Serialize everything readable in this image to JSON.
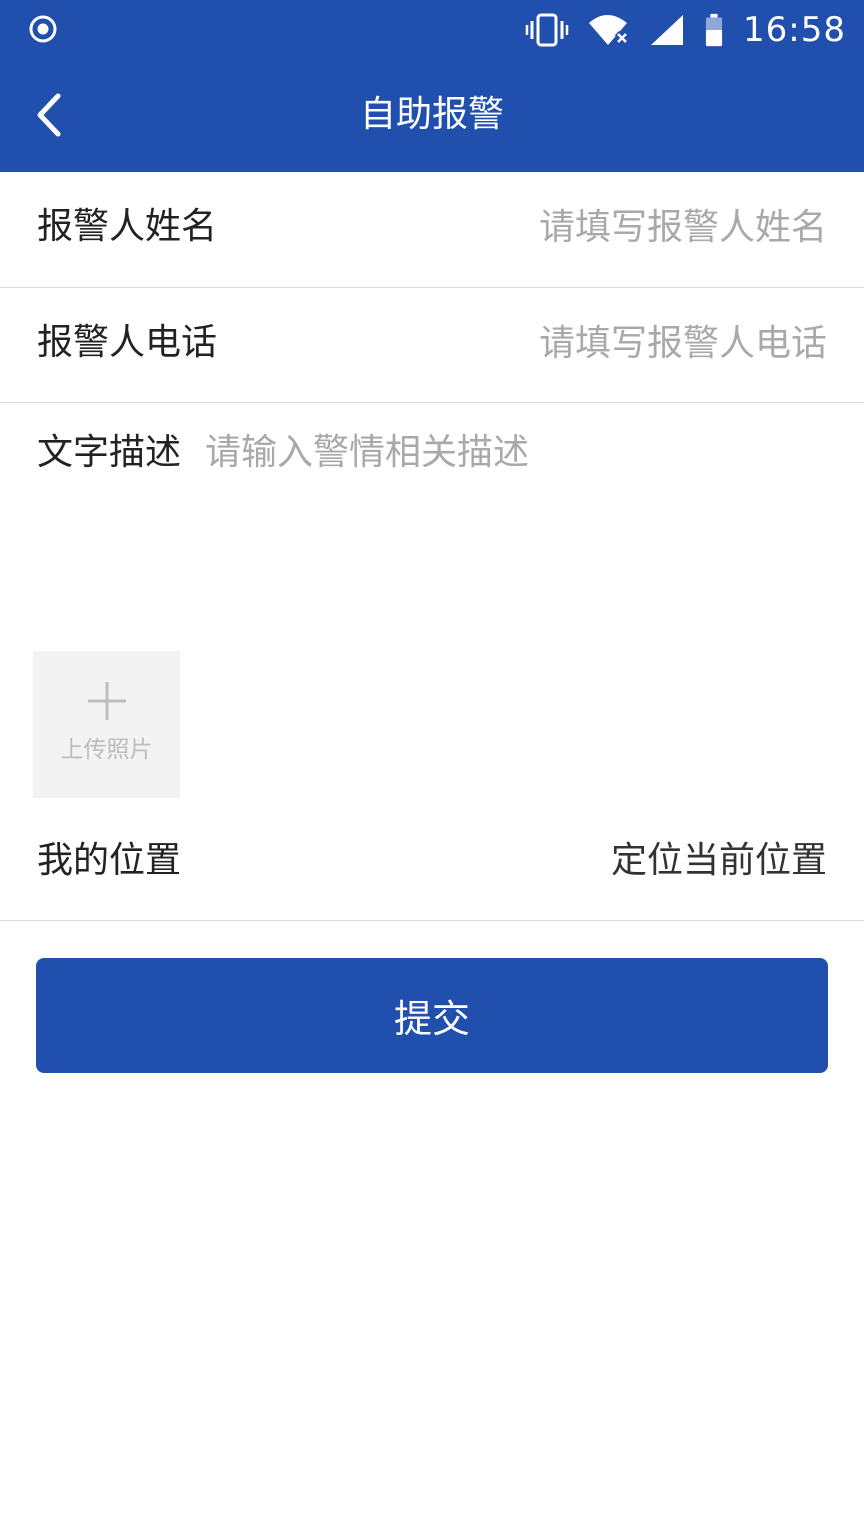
{
  "status_bar": {
    "time": "16:58",
    "icons": [
      "record-icon",
      "vibrate-icon",
      "wifi-no-internet-icon",
      "signal-icon",
      "battery-icon"
    ]
  },
  "nav": {
    "title": "自助报警",
    "back_icon": "chevron-left-icon"
  },
  "form": {
    "name": {
      "label": "报警人姓名",
      "value": "",
      "placeholder": "请填写报警人姓名"
    },
    "phone": {
      "label": "报警人电话",
      "value": "",
      "placeholder": "请填写报警人电话"
    },
    "description": {
      "label": "文字描述",
      "value": "",
      "placeholder": "请输入警情相关描述"
    },
    "upload": {
      "label": "上传照片",
      "icon": "plus-icon"
    },
    "location": {
      "label": "我的位置",
      "action": "定位当前位置"
    }
  },
  "submit": {
    "label": "提交"
  },
  "colors": {
    "primary": "#214fae",
    "placeholder": "#a9a9a9",
    "divider": "#d9d9d9",
    "upload_bg": "#f3f3f3"
  }
}
